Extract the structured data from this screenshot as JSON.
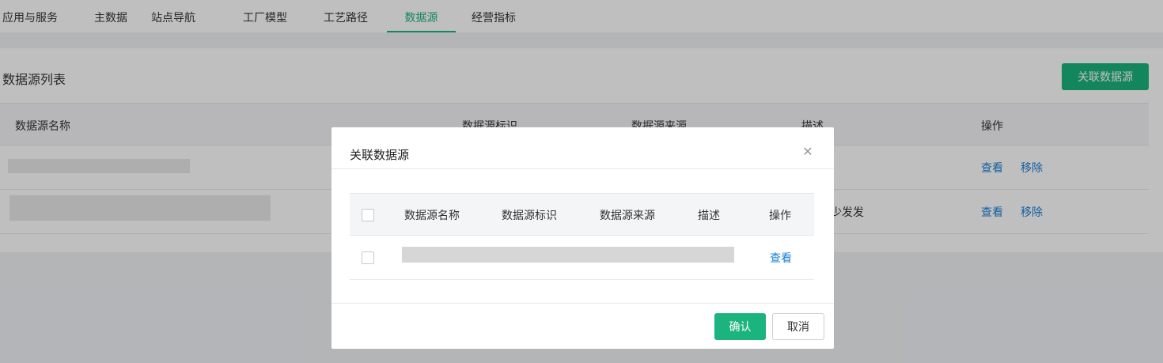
{
  "tabs": [
    {
      "label": "应用与服务"
    },
    {
      "label": "主数据"
    },
    {
      "label": "站点导航"
    },
    {
      "label": "工厂模型"
    },
    {
      "label": "工艺路径"
    },
    {
      "label": "数据源",
      "active": true
    },
    {
      "label": "经营指标"
    }
  ],
  "panel": {
    "title": "数据源列表",
    "associate_button": "关联数据源"
  },
  "table": {
    "columns": [
      "数据源名称",
      "数据源标识",
      "数据源来源",
      "描述",
      "操作"
    ],
    "rows": [
      {
        "description": "",
        "actions": [
          "查看",
          "移除"
        ]
      },
      {
        "description": "少发发",
        "actions": [
          "查看",
          "移除"
        ]
      }
    ]
  },
  "dialog": {
    "title": "关联数据源",
    "close_icon": "close-icon",
    "columns": [
      "数据源名称",
      "数据源标识",
      "数据源来源",
      "描述",
      "操作"
    ],
    "rows": [
      {
        "action": "查看"
      }
    ],
    "confirm_label": "确认",
    "cancel_label": "取消"
  },
  "colors": {
    "primary": "#1bb37e",
    "link": "#1a7fd4",
    "page_bg": "#f0f2f5"
  }
}
